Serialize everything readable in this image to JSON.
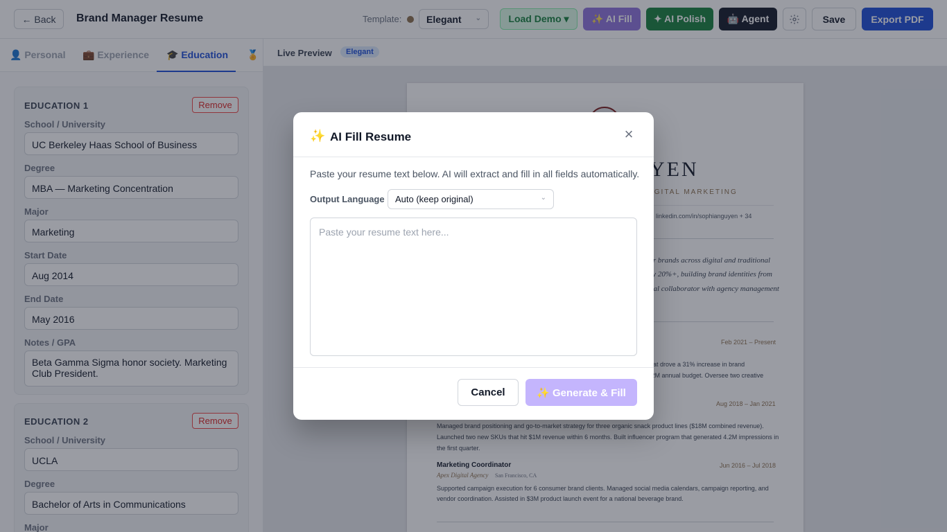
{
  "header": {
    "back_label": "← Back",
    "title": "Brand Manager Resume",
    "template_label": "Template:",
    "template_value": "Elegant",
    "load_demo_label": "Load Demo ▾",
    "ai_fill_label": "✨ AI Fill",
    "ai_polish_label": "✦ AI Polish",
    "agent_label": "🤖 Agent",
    "settings_icon": "gear-icon",
    "save_label": "Save",
    "export_label": "Export PDF"
  },
  "tabs": [
    {
      "icon": "👤",
      "label": "Personal"
    },
    {
      "icon": "💼",
      "label": "Experience"
    },
    {
      "icon": "🎓",
      "label": "Education"
    },
    {
      "icon": "🏅",
      "label": ""
    }
  ],
  "education": [
    {
      "title": "EDUCATION 1",
      "remove_label": "Remove",
      "fields": [
        {
          "label": "School / University",
          "value": "UC Berkeley Haas School of Business"
        },
        {
          "label": "Degree",
          "value": "MBA — Marketing Concentration"
        },
        {
          "label": "Major",
          "value": "Marketing"
        },
        {
          "label": "Start Date",
          "value": "Aug 2014"
        },
        {
          "label": "End Date",
          "value": "May 2016"
        },
        {
          "label": "Notes / GPA",
          "value": "Beta Gamma Sigma honor society. Marketing Club President."
        }
      ]
    },
    {
      "title": "EDUCATION 2",
      "remove_label": "Remove",
      "fields": [
        {
          "label": "School / University",
          "value": "UCLA"
        },
        {
          "label": "Degree",
          "value": "Bachelor of Arts in Communications"
        },
        {
          "label": "Major",
          "value": ""
        }
      ]
    }
  ],
  "preview": {
    "label": "Live Preview",
    "badge": "Elegant",
    "resume": {
      "name_fragment": "YEN",
      "subtitle_fragment": "IGITAL MARKETING",
      "contact_fragment": "linkedin.com/in/sophianguyen + 34",
      "summary_lines": [
        "er brands across digital and traditional",
        "ry 20%+, building brand identities from",
        "nal collaborator with agency management"
      ],
      "job1_date": "Feb 2021 – Present",
      "job1_lines": [
        "hat drove a 31% increase in brand",
        ".2M annual budget. Oversee two creative"
      ],
      "job2_date": "Aug 2018 – Jan 2021",
      "job2_lines": [
        "Managed brand positioning and go-to-market strategy for three organic snack product lines ($18M combined revenue).",
        "Launched two new SKUs that hit $1M revenue within 6 months. Built influencer program that generated 4.2M impressions in",
        "the first quarter."
      ],
      "job3_title": "Marketing Coordinator",
      "job3_date": "Jun 2016 – Jul 2018",
      "job3_company": "Apex Digital Agency",
      "job3_location": "San Francisco, CA",
      "job3_lines": [
        "Supported campaign execution for 6 consumer brand clients. Managed social media calendars, campaign reporting, and",
        "vendor coordination. Assisted in $3M product launch event for a national beverage brand."
      ]
    }
  },
  "modal": {
    "icon": "✨",
    "title": "AI Fill Resume",
    "close_icon": "×",
    "description": "Paste your resume text below. AI will extract and fill in all fields automatically.",
    "language_label": "Output Language",
    "language_value": "Auto (keep original)",
    "textarea_placeholder": "Paste your resume text here...",
    "cancel_label": "Cancel",
    "generate_label": "✨ Generate & Fill"
  },
  "colors": {
    "primary": "#1d4ed8",
    "ai_fill": "#7c5cd6",
    "ai_polish": "#16803c",
    "agent": "#111827",
    "danger": "#dc2626",
    "generate_disabled": "#c4b5fd"
  }
}
